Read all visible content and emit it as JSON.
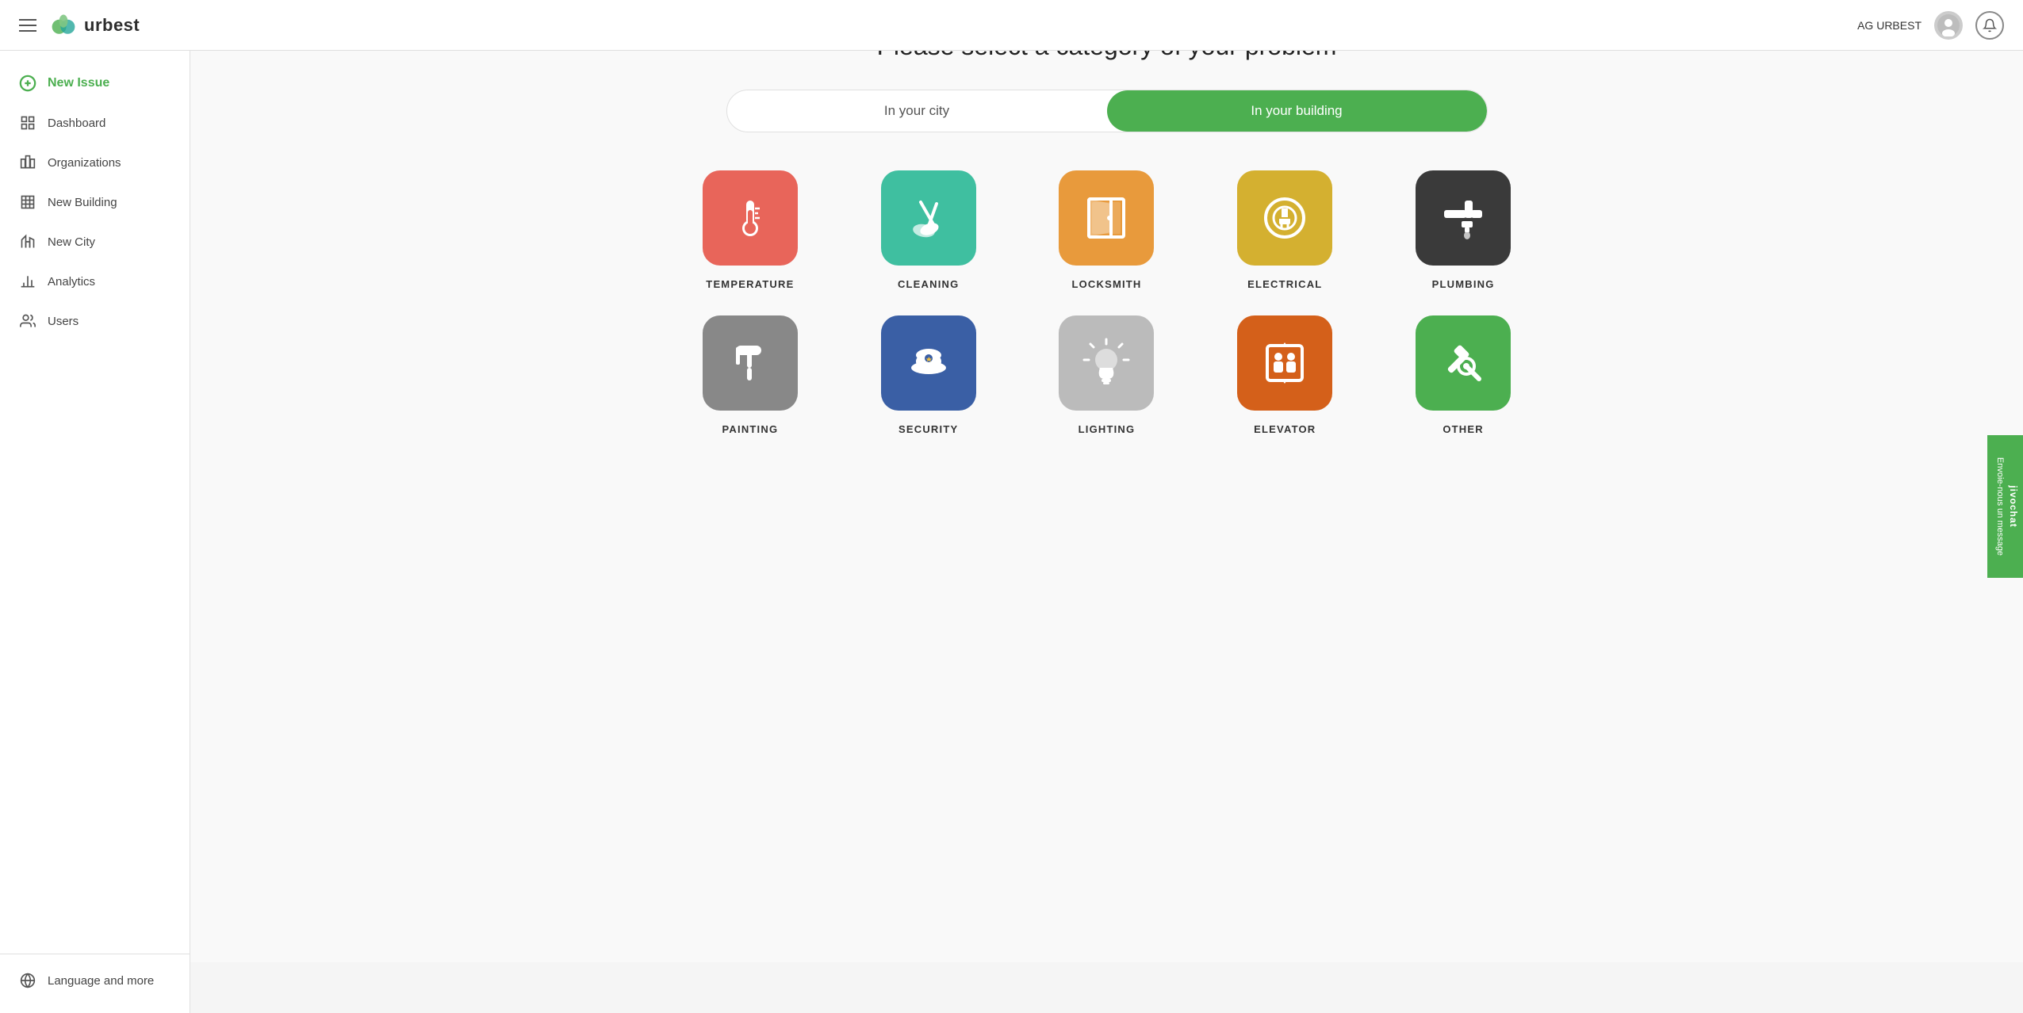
{
  "header": {
    "menu_icon": "hamburger-icon",
    "logo_text": "urbest",
    "user_name": "AG URBEST",
    "bell_icon": "bell-icon"
  },
  "sidebar": {
    "items": [
      {
        "id": "new-issue",
        "label": "New Issue",
        "icon": "plus-circle-icon",
        "special": true
      },
      {
        "id": "dashboard",
        "label": "Dashboard",
        "icon": "dashboard-icon"
      },
      {
        "id": "organizations",
        "label": "Organizations",
        "icon": "organizations-icon"
      },
      {
        "id": "new-building",
        "label": "New Building",
        "icon": "building-icon"
      },
      {
        "id": "new-city",
        "label": "New City",
        "icon": "city-icon"
      },
      {
        "id": "analytics",
        "label": "Analytics",
        "icon": "analytics-icon"
      },
      {
        "id": "users",
        "label": "Users",
        "icon": "users-icon"
      }
    ],
    "bottom_item": {
      "id": "language",
      "label": "Language and more",
      "icon": "globe-icon"
    }
  },
  "main": {
    "page_title": "Please select a category of your problem",
    "toggle": {
      "city_label": "In your city",
      "building_label": "In your building",
      "active": "building"
    },
    "categories_row1": [
      {
        "id": "temperature",
        "label": "TEMPERATURE",
        "color": "#e8655a",
        "icon": "thermometer-icon"
      },
      {
        "id": "cleaning",
        "label": "CLEANING",
        "color": "#3fbfa0",
        "icon": "cleaning-icon"
      },
      {
        "id": "locksmith",
        "label": "LOCKSMITH",
        "color": "#e89a3c",
        "icon": "door-icon"
      },
      {
        "id": "electrical",
        "label": "ELECTRICAL",
        "color": "#d4b030",
        "icon": "electrical-icon"
      },
      {
        "id": "plumbing",
        "label": "PLUMBING",
        "color": "#3a3a3a",
        "icon": "plumbing-icon"
      }
    ],
    "categories_row2": [
      {
        "id": "painting",
        "label": "PAINTING",
        "color": "#888888",
        "icon": "roller-icon"
      },
      {
        "id": "security",
        "label": "SECURITY",
        "color": "#3a5fa5",
        "icon": "security-icon"
      },
      {
        "id": "lighting",
        "label": "LIGHTING",
        "color": "#bbbbbb",
        "icon": "light-icon"
      },
      {
        "id": "elevator",
        "label": "ELEVATOR",
        "color": "#d4601a",
        "icon": "elevator-icon"
      },
      {
        "id": "other",
        "label": "OTHER",
        "color": "#4caf50",
        "icon": "tools-icon"
      }
    ]
  },
  "jivochat": {
    "label": "jivochat",
    "message_label": "Envoie-nous un message"
  }
}
